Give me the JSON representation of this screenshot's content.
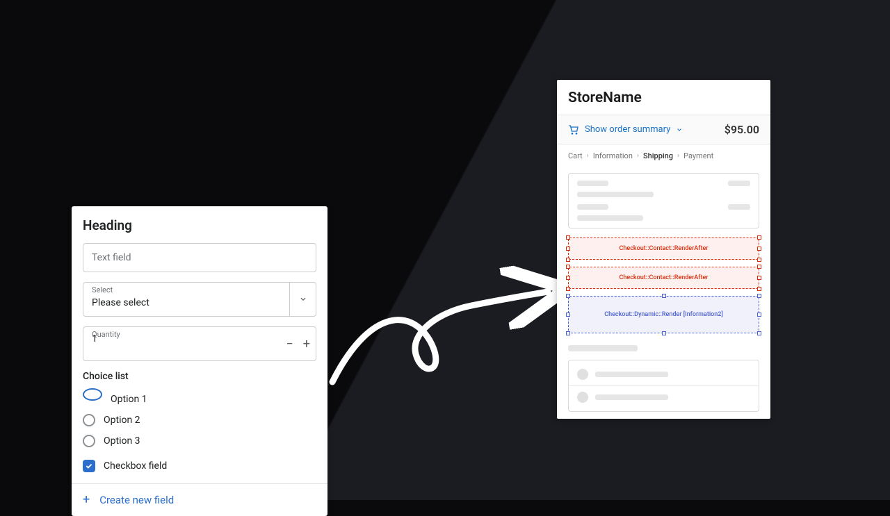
{
  "form": {
    "heading": "Heading",
    "textfield_placeholder": "Text field",
    "select": {
      "label": "Select",
      "value": "Please select"
    },
    "quantity": {
      "label": "Quantity",
      "value": "1"
    },
    "choice_list_title": "Choice list",
    "options": [
      "Option 1",
      "Option 2",
      "Option 3"
    ],
    "checkbox_label": "Checkbox field",
    "create_label": "Create new field"
  },
  "checkout": {
    "store_name": "StoreName",
    "summary_label": "Show order summary",
    "total": "$95.00",
    "breadcrumbs": [
      "Cart",
      "Information",
      "Shipping",
      "Payment"
    ],
    "ext1": "Checkout::Contact::RenderAfter",
    "ext2": "Checkout::Contact::RenderAfter",
    "ext3": "Checkout::Dynamic::Render [Information2]"
  }
}
